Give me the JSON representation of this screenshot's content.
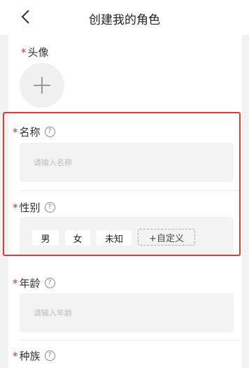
{
  "header": {
    "title": "创建我的角色",
    "back_icon": "chevron-left-icon"
  },
  "form": {
    "required_mark": "*",
    "help_icon": "question-circle-icon",
    "avatar": {
      "label": "头像",
      "add_icon": "plus-icon"
    },
    "name": {
      "label": "名称",
      "placeholder": "请输入名称"
    },
    "gender": {
      "label": "性别",
      "options": [
        "男",
        "女",
        "未知"
      ],
      "custom_label": "+自定义"
    },
    "age": {
      "label": "年龄",
      "placeholder": "请输入年龄"
    },
    "race": {
      "label": "种族"
    }
  },
  "colors": {
    "required": "#e02d2d",
    "highlight": "#e53935",
    "input_bg": "#f3f3f3",
    "page_bg": "#f2f2f2"
  }
}
